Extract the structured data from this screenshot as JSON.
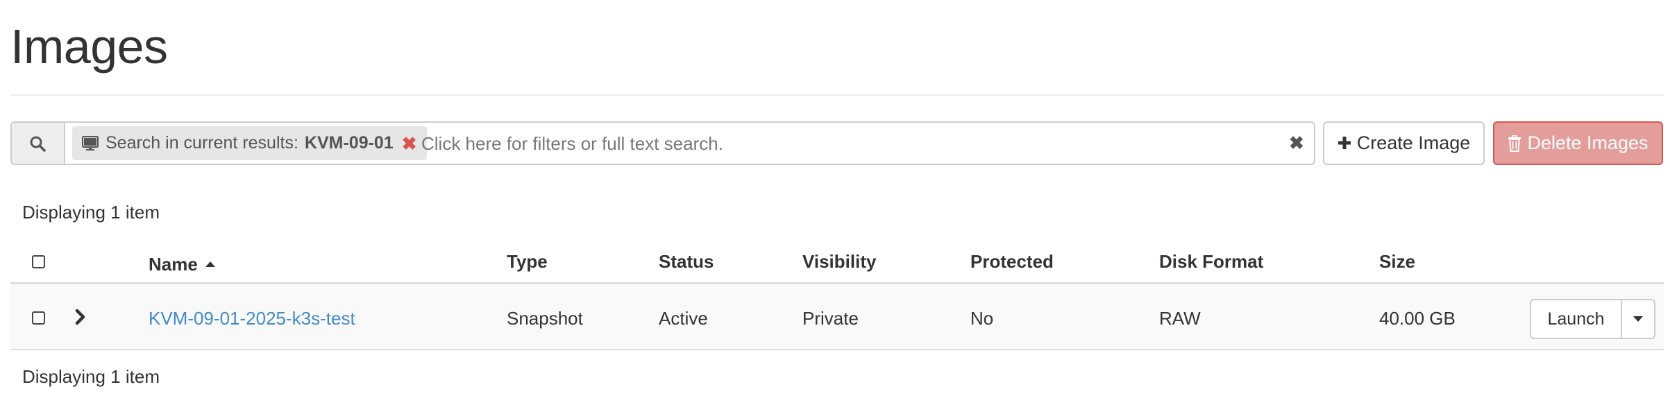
{
  "page": {
    "title": "Images"
  },
  "search": {
    "facet_label": "Search in current results:",
    "facet_value": "KVM-09-01",
    "facet_remove": "✖",
    "placeholder": "Click here for filters or full text search.",
    "clear": "✖"
  },
  "actions": {
    "create_label": "Create Image",
    "delete_label": "Delete Images"
  },
  "summary": {
    "top": "Displaying 1 item",
    "bottom": "Displaying 1 item"
  },
  "table": {
    "columns": [
      "Name",
      "Type",
      "Status",
      "Visibility",
      "Protected",
      "Disk Format",
      "Size"
    ],
    "sorted_column": "Name",
    "sort_direction": "ascending",
    "rows": [
      {
        "name": "KVM-09-01-2025-k3s-test",
        "type": "Snapshot",
        "status": "Active",
        "visibility": "Private",
        "protected": "No",
        "disk_format": "RAW",
        "size": "40.00 GB",
        "action": "Launch"
      }
    ]
  },
  "icons": {
    "search": "search-icon",
    "facet": "monitor-icon",
    "create": "plus-icon",
    "delete": "trash-icon",
    "expand": "chevron-right-icon",
    "sort": "caret-up-icon",
    "dropdown": "caret-down-icon"
  },
  "colors": {
    "link": "#428bca",
    "danger": "#d9534f",
    "danger_disabled_bg": "#e39e9b",
    "row_bg": "#f9f9f9"
  }
}
